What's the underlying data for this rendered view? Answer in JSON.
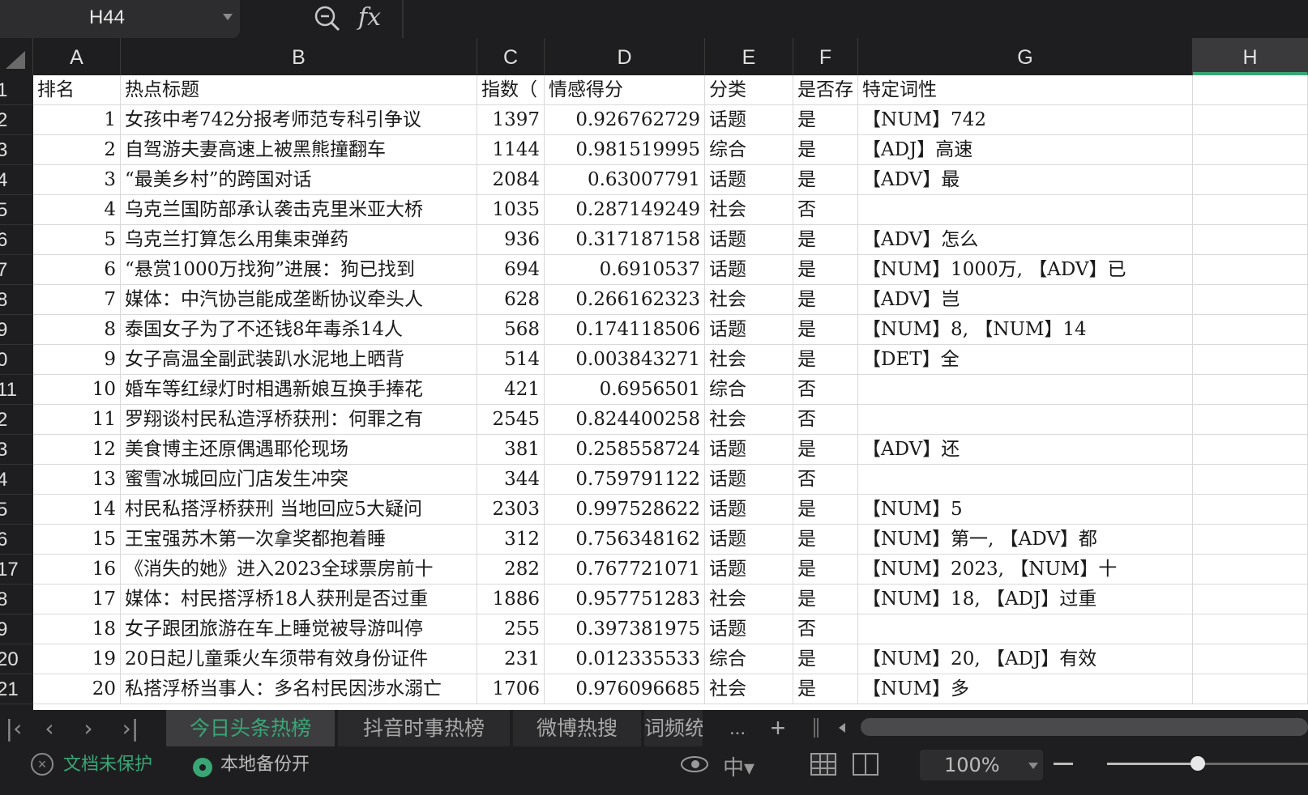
{
  "formula_bar": {
    "cell_ref": "H44",
    "fx_label": "fx",
    "formula_value": ""
  },
  "columns": [
    "A",
    "B",
    "C",
    "D",
    "E",
    "F",
    "G",
    "H"
  ],
  "active_column": "H",
  "header_row": {
    "row_label": "1",
    "cells": [
      "排名",
      "热点标题",
      "指数（",
      "情感得分",
      "分类",
      "是否存",
      "特定词性",
      ""
    ]
  },
  "rows": [
    {
      "row_label": "2",
      "rank": "1",
      "title": "女孩中考742分报考师范专科引争议",
      "index": "1397",
      "sentiment": "0.926762729",
      "category": "话题",
      "has": "是",
      "pos": "【NUM】742"
    },
    {
      "row_label": "3",
      "rank": "2",
      "title": "自驾游夫妻高速上被黑熊撞翻车",
      "index": "1144",
      "sentiment": "0.981519995",
      "category": "综合",
      "has": "是",
      "pos": "【ADJ】高速"
    },
    {
      "row_label": "4",
      "rank": "3",
      "title": "“最美乡村”的跨国对话",
      "index": "2084",
      "sentiment": "0.63007791",
      "category": "话题",
      "has": "是",
      "pos": "【ADV】最"
    },
    {
      "row_label": "5",
      "rank": "4",
      "title": "乌克兰国防部承认袭击克里米亚大桥",
      "index": "1035",
      "sentiment": "0.287149249",
      "category": "社会",
      "has": "否",
      "pos": ""
    },
    {
      "row_label": "6",
      "rank": "5",
      "title": "乌克兰打算怎么用集束弹药",
      "index": "936",
      "sentiment": "0.317187158",
      "category": "话题",
      "has": "是",
      "pos": "【ADV】怎么"
    },
    {
      "row_label": "7",
      "rank": "6",
      "title": "“悬赏1000万找狗”进展：狗已找到",
      "index": "694",
      "sentiment": "0.6910537",
      "category": "话题",
      "has": "是",
      "pos": "【NUM】1000万, 【ADV】已"
    },
    {
      "row_label": "8",
      "rank": "7",
      "title": "媒体：中汽协岂能成垄断协议牵头人",
      "index": "628",
      "sentiment": "0.266162323",
      "category": "社会",
      "has": "是",
      "pos": "【ADV】岂"
    },
    {
      "row_label": "9",
      "rank": "8",
      "title": "泰国女子为了不还钱8年毒杀14人",
      "index": "568",
      "sentiment": "0.174118506",
      "category": "话题",
      "has": "是",
      "pos": "【NUM】8, 【NUM】14"
    },
    {
      "row_label": "0",
      "rank": "9",
      "title": "女子高温全副武装趴水泥地上晒背",
      "index": "514",
      "sentiment": "0.003843271",
      "category": "社会",
      "has": "是",
      "pos": "【DET】全"
    },
    {
      "row_label": "11",
      "rank": "10",
      "title": "婚车等红绿灯时相遇新娘互换手捧花",
      "index": "421",
      "sentiment": "0.6956501",
      "category": "综合",
      "has": "否",
      "pos": ""
    },
    {
      "row_label": "2",
      "rank": "11",
      "title": "罗翔谈村民私造浮桥获刑：何罪之有",
      "index": "2545",
      "sentiment": "0.824400258",
      "category": "社会",
      "has": "否",
      "pos": ""
    },
    {
      "row_label": "3",
      "rank": "12",
      "title": "美食博主还原偶遇耶伦现场",
      "index": "381",
      "sentiment": "0.258558724",
      "category": "话题",
      "has": "是",
      "pos": "【ADV】还"
    },
    {
      "row_label": "4",
      "rank": "13",
      "title": "蜜雪冰城回应门店发生冲突",
      "index": "344",
      "sentiment": "0.759791122",
      "category": "话题",
      "has": "否",
      "pos": ""
    },
    {
      "row_label": "5",
      "rank": "14",
      "title": "村民私搭浮桥获刑 当地回应5大疑问",
      "index": "2303",
      "sentiment": "0.997528622",
      "category": "话题",
      "has": "是",
      "pos": "【NUM】5"
    },
    {
      "row_label": "6",
      "rank": "15",
      "title": "王宝强苏木第一次拿奖都抱着睡",
      "index": "312",
      "sentiment": "0.756348162",
      "category": "话题",
      "has": "是",
      "pos": "【NUM】第一, 【ADV】都"
    },
    {
      "row_label": "17",
      "rank": "16",
      "title": "《消失的她》进入2023全球票房前十",
      "index": "282",
      "sentiment": "0.767721071",
      "category": "话题",
      "has": "是",
      "pos": "【NUM】2023, 【NUM】十"
    },
    {
      "row_label": "8",
      "rank": "17",
      "title": "媒体：村民搭浮桥18人获刑是否过重",
      "index": "1886",
      "sentiment": "0.957751283",
      "category": "社会",
      "has": "是",
      "pos": "【NUM】18, 【ADJ】过重"
    },
    {
      "row_label": "9",
      "rank": "18",
      "title": "女子跟团旅游在车上睡觉被导游叫停",
      "index": "255",
      "sentiment": "0.397381975",
      "category": "话题",
      "has": "否",
      "pos": ""
    },
    {
      "row_label": "20",
      "rank": "19",
      "title": "20日起儿童乘火车须带有效身份证件",
      "index": "231",
      "sentiment": "0.012335533",
      "category": "综合",
      "has": "是",
      "pos": "【NUM】20, 【ADJ】有效"
    },
    {
      "row_label": "21",
      "rank": "20",
      "title": "私搭浮桥当事人：多名村民因涉水溺亡",
      "index": "1706",
      "sentiment": "0.976096685",
      "category": "社会",
      "has": "是",
      "pos": "【NUM】多"
    }
  ],
  "sheet_tabs": [
    {
      "label": "今日头条热榜",
      "active": true
    },
    {
      "label": "抖音时事热榜",
      "active": false
    },
    {
      "label": "微博热搜",
      "active": false
    },
    {
      "label": "词频统计",
      "active": false
    }
  ],
  "tabs_more": "...",
  "tabs_add": "+",
  "status": {
    "protection": "文档未保护",
    "backup": "本地备份开",
    "zoom": "100%",
    "zoom_fraction": 0.45
  },
  "colors": {
    "accent": "#3aa676",
    "dark_bg": "#1e1e20",
    "grid_line": "#d9d9d9"
  }
}
